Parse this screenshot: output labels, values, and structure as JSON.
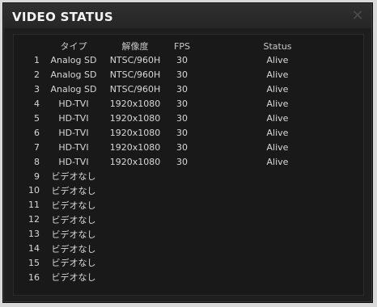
{
  "window": {
    "title": "VIDEO STATUS",
    "close_glyph": "✕"
  },
  "columns": [
    "",
    "タイプ",
    "解像度",
    "FPS",
    "Status"
  ],
  "rows": [
    {
      "no": "1",
      "type": "Analog SD",
      "res": "NTSC/960H",
      "fps": "30",
      "status": "Alive"
    },
    {
      "no": "2",
      "type": "Analog SD",
      "res": "NTSC/960H",
      "fps": "30",
      "status": "Alive"
    },
    {
      "no": "3",
      "type": "Analog SD",
      "res": "NTSC/960H",
      "fps": "30",
      "status": "Alive"
    },
    {
      "no": "4",
      "type": "HD-TVI",
      "res": "1920x1080",
      "fps": "30",
      "status": "Alive"
    },
    {
      "no": "5",
      "type": "HD-TVI",
      "res": "1920x1080",
      "fps": "30",
      "status": "Alive"
    },
    {
      "no": "6",
      "type": "HD-TVI",
      "res": "1920x1080",
      "fps": "30",
      "status": "Alive"
    },
    {
      "no": "7",
      "type": "HD-TVI",
      "res": "1920x1080",
      "fps": "30",
      "status": "Alive"
    },
    {
      "no": "8",
      "type": "HD-TVI",
      "res": "1920x1080",
      "fps": "30",
      "status": "Alive"
    },
    {
      "no": "9",
      "type": "ビデオなし",
      "res": "",
      "fps": "",
      "status": ""
    },
    {
      "no": "10",
      "type": "ビデオなし",
      "res": "",
      "fps": "",
      "status": ""
    },
    {
      "no": "11",
      "type": "ビデオなし",
      "res": "",
      "fps": "",
      "status": ""
    },
    {
      "no": "12",
      "type": "ビデオなし",
      "res": "",
      "fps": "",
      "status": ""
    },
    {
      "no": "13",
      "type": "ビデオなし",
      "res": "",
      "fps": "",
      "status": ""
    },
    {
      "no": "14",
      "type": "ビデオなし",
      "res": "",
      "fps": "",
      "status": ""
    },
    {
      "no": "15",
      "type": "ビデオなし",
      "res": "",
      "fps": "",
      "status": ""
    },
    {
      "no": "16",
      "type": "ビデオなし",
      "res": "",
      "fps": "",
      "status": ""
    }
  ]
}
